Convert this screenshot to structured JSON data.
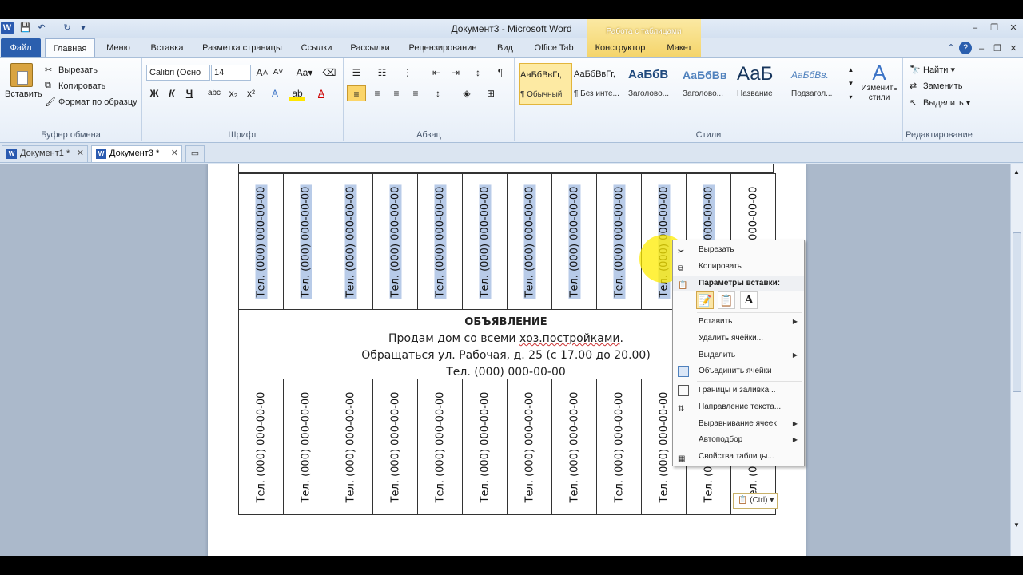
{
  "window": {
    "title": "Документ3 - Microsoft Word",
    "contextual_tab": "Работа с таблицами"
  },
  "ribbon_tabs": [
    "Файл",
    "Главная",
    "Меню",
    "Вставка",
    "Разметка страницы",
    "Ссылки",
    "Рассылки",
    "Рецензирование",
    "Вид",
    "Office Tab",
    "Конструктор",
    "Макет"
  ],
  "clipboard": {
    "paste": "Вставить",
    "cut": "Вырезать",
    "copy": "Копировать",
    "format_painter": "Формат по образцу",
    "label": "Буфер обмена"
  },
  "font": {
    "name": "Calibri (Осно",
    "size": "14",
    "label": "Шрифт",
    "buttons": [
      "Ж",
      "К",
      "Ч",
      "abc",
      "x₂",
      "x²"
    ]
  },
  "paragraph": {
    "label": "Абзац"
  },
  "styles": {
    "label": "Стили",
    "items": [
      {
        "sample": "АаБбВвГг,",
        "name": "¶ Обычный"
      },
      {
        "sample": "АаБбВвГг,",
        "name": "¶ Без инте..."
      },
      {
        "sample": "АаБбВ",
        "name": "Заголово..."
      },
      {
        "sample": "АаБбВв",
        "name": "Заголово..."
      },
      {
        "sample": "АаБ",
        "name": "Название"
      },
      {
        "sample": "АаБбВв.",
        "name": "Подзагол..."
      }
    ],
    "change": "Изменить стили"
  },
  "editing": {
    "label": "Редактирование",
    "find": "Найти",
    "replace": "Заменить",
    "select": "Выделить"
  },
  "doc_tabs": [
    "Документ1 *",
    "Документ3 *"
  ],
  "document": {
    "phone": "Тел. (000) 000-00-00",
    "heading": "ОБЪЯВЛЕНИЕ",
    "line1_start": "Продам дом со всеми ",
    "line1_squiggle": "хоз.постройками",
    "line1_end": ".",
    "line2": "Обращаться ул. Рабочая, д. 25 (с 17.00 до 20.00)",
    "line3": "Тел. (000) 000-00-00"
  },
  "context_menu": {
    "cut": "Вырезать",
    "copy": "Копировать",
    "paste_options": "Параметры вставки:",
    "insert": "Вставить",
    "delete_cells": "Удалить ячейки...",
    "select": "Выделить",
    "merge_cells": "Объединить ячейки",
    "borders": "Границы и заливка...",
    "text_direction": "Направление текста...",
    "cell_alignment": "Выравнивание ячеек",
    "autofit": "Автоподбор",
    "table_properties": "Свойства таблицы..."
  },
  "paste_ctrl": "(Ctrl)"
}
